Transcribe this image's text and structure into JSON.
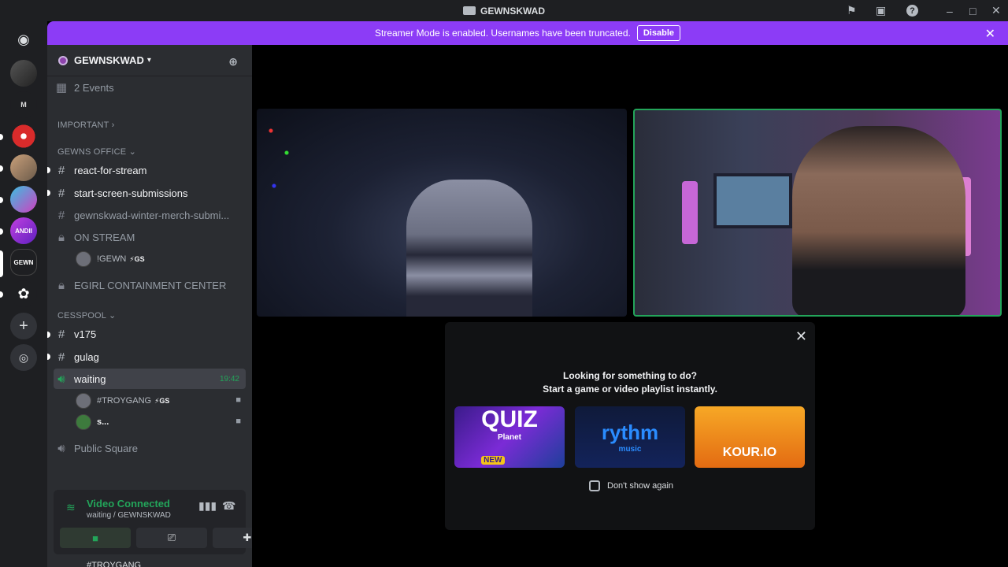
{
  "window": {
    "title": "GEWNSKWAD"
  },
  "banner": {
    "message": "Streamer Mode is enabled. Usernames have been truncated.",
    "disable_label": "Disable"
  },
  "guild": {
    "name": "GEWNSKWAD",
    "events_label": "2 Events"
  },
  "categories": {
    "important": "IMPORTANT",
    "gewns_office": "GEWNS OFFICE",
    "cesspool": "CESSPOOL"
  },
  "channels": {
    "react_for_stream": "react-for-stream",
    "start_screen_submissions": "start-screen-submissions",
    "winter_merch": "gewnskwad-winter-merch-submi...",
    "on_stream": "ON STREAM",
    "egirl": "EGIRL CONTAINMENT CENTER",
    "v175": "v175",
    "gulag": "gulag",
    "waiting": "waiting",
    "waiting_time": "19:42",
    "public_square": "Public Square"
  },
  "voice_users": {
    "on_stream_user": "!GEWN",
    "on_stream_badge": "GS",
    "waiting_user_1": "#TROYGANG",
    "waiting_user_1_badge": "GS",
    "waiting_user_2": "s..."
  },
  "voice_panel": {
    "status": "Video Connected",
    "location": "waiting / GEWNSKWAD"
  },
  "user_bar": {
    "name": "#TROYGANG"
  },
  "activity": {
    "line1": "Looking for something to do?",
    "line2": "Start a game or video playlist instantly.",
    "cards": {
      "quiz_title": "QUIZ",
      "quiz_sub": "Planet",
      "quiz_badge": "NEW",
      "rythm_title": "rythm",
      "rythm_sub": "music",
      "kour_title": "KOUR.IO"
    },
    "dont_show": "Don't show again"
  },
  "colors": {
    "banner": "#8c3cf6",
    "connected": "#23a55a",
    "sidebar": "#2b2d31",
    "rail": "#1e1f22"
  }
}
